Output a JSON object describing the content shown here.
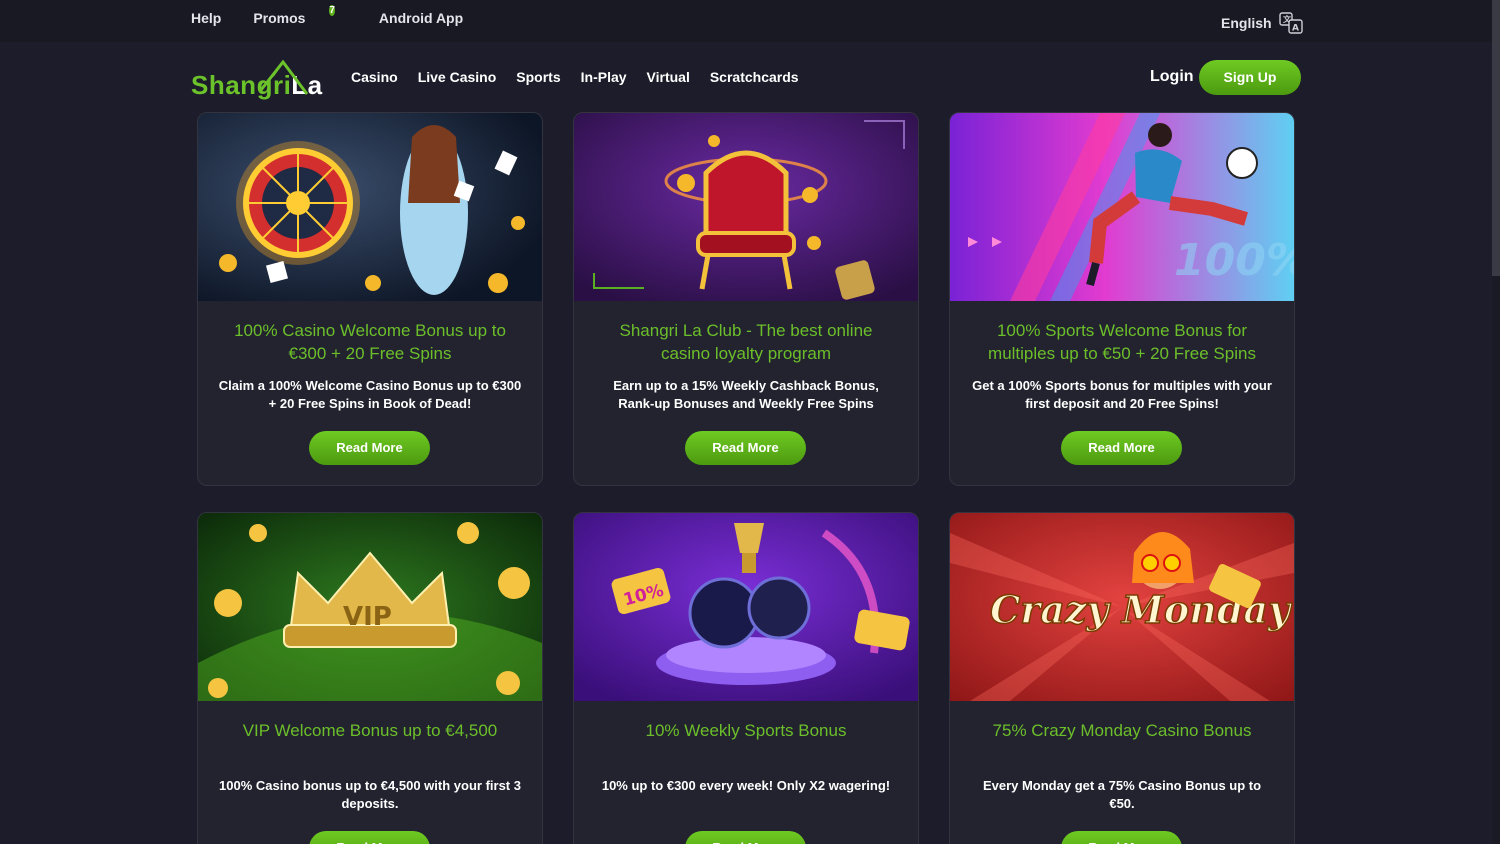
{
  "topbar": {
    "links": [
      "Help",
      "Promos",
      "Android App"
    ],
    "promo_badge": "7",
    "language": "English"
  },
  "nav": {
    "logo_main": "Shangri",
    "logo_accent": "La",
    "items": [
      "Casino",
      "Live Casino",
      "Sports",
      "In-Play",
      "Virtual",
      "Scratchcards"
    ],
    "login": "Login",
    "signup": "Sign Up"
  },
  "colors": {
    "brand_green": "#6cbf2a",
    "background": "#1c1c2a",
    "card": "#22232f"
  },
  "cards": [
    {
      "title": "100% Casino Welcome Bonus up to €300 + 20 Free Spins",
      "desc": "Claim a 100% Welcome Casino Bonus up to €300 + 20 Free Spins in Book of Dead!",
      "button": "Read More"
    },
    {
      "title": "Shangri La Club - The best online casino loyalty program",
      "desc": "Earn up to a 15% Weekly Cashback Bonus, Rank-up Bonuses and Weekly Free Spins",
      "button": "Read More"
    },
    {
      "title": "100% Sports Welcome Bonus for multiples up to €50 + 20 Free Spins",
      "desc": "Get a 100% Sports bonus for multiples with your first deposit and 20 Free Spins!",
      "button": "Read More",
      "image_text": "100%"
    },
    {
      "title": "VIP Welcome Bonus up to €4,500",
      "desc": "100% Casino bonus up to €4,500 with your first 3 deposits.",
      "button": "Read More",
      "image_text": "VIP"
    },
    {
      "title": "10% Weekly Sports Bonus",
      "desc": "10% up to €300 every week! Only X2 wagering!",
      "button": "Read More",
      "image_text": "10%"
    },
    {
      "title": "75% Crazy Monday Casino Bonus",
      "desc": "Every Monday get a 75% Casino Bonus up to €50.",
      "button": "Read More",
      "image_text": "Crazy Monday"
    }
  ]
}
